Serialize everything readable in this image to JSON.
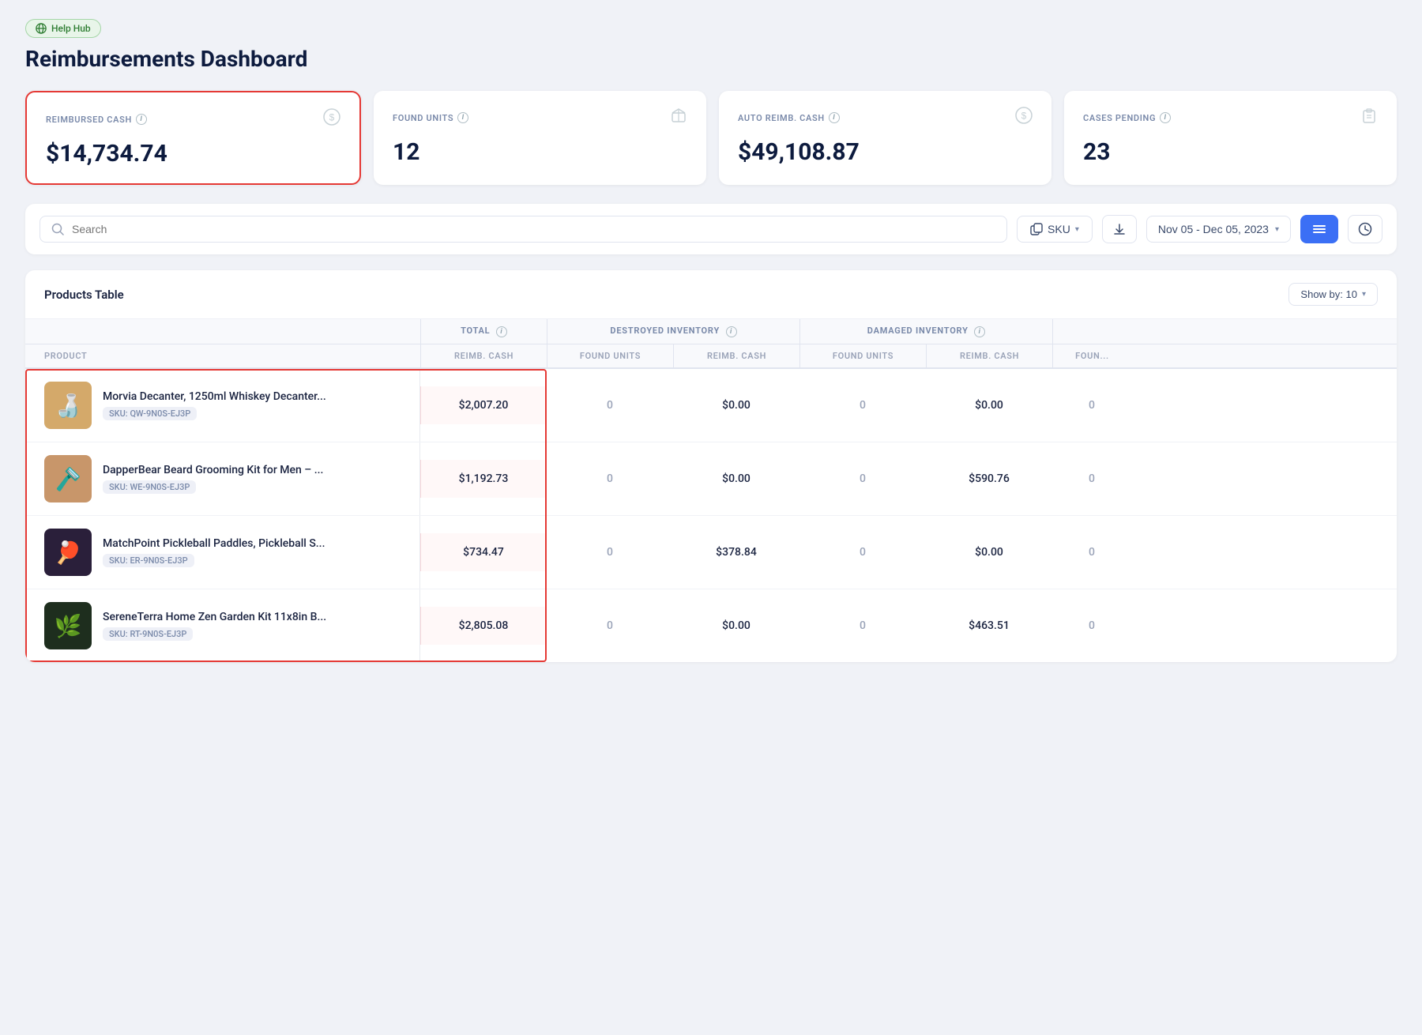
{
  "badge": {
    "label": "Help Hub",
    "icon": "globe"
  },
  "page": {
    "title": "Reimbursements Dashboard"
  },
  "stats": [
    {
      "id": "reimbursed-cash",
      "label": "REIMBURSED CASH",
      "value": "$14,734.74",
      "icon": "dollar",
      "highlighted": true
    },
    {
      "id": "found-units",
      "label": "FOUND UNITS",
      "value": "12",
      "icon": "cube",
      "highlighted": false
    },
    {
      "id": "auto-reimb-cash",
      "label": "AUTO REIMB. CASH",
      "value": "$49,108.87",
      "icon": "dollar",
      "highlighted": false
    },
    {
      "id": "cases-pending",
      "label": "CASES PENDING",
      "value": "23",
      "icon": "clipboard",
      "highlighted": false
    }
  ],
  "toolbar": {
    "search_placeholder": "Search",
    "sku_label": "SKU",
    "date_range": "Nov 05 - Dec 05, 2023",
    "show_by_label": "Show by: 10"
  },
  "table": {
    "title": "Products Table",
    "show_by_label": "Show by: 10",
    "col_groups": [
      {
        "label": "",
        "span": 1
      },
      {
        "label": "TOTAL",
        "span": 2
      },
      {
        "label": "DESTROYED INVENTORY",
        "span": 2
      },
      {
        "label": "DAMAGED INVENTORY",
        "span": 2
      }
    ],
    "sub_cols": [
      "PRODUCT",
      "REIMB. CASH",
      "FOUND UNITS",
      "REIMB. CASH",
      "FOUND UNITS",
      "REIMB. CASH",
      "FOUN..."
    ],
    "rows": [
      {
        "name": "Morvia Decanter, 1250ml Whiskey Decanter...",
        "sku": "QW-9N0S-EJ3P",
        "reimb_cash_total": "$2,007.20",
        "found_units_total": "0",
        "destroyed_reimb": "$0.00",
        "destroyed_found": "0",
        "damaged_reimb": "$0.00",
        "damaged_found": "0",
        "thumb_bg": "#d4a96a",
        "thumb_label": "🍶"
      },
      {
        "name": "DapperBear Beard Grooming Kit for Men – ...",
        "sku": "WE-9N0S-EJ3P",
        "reimb_cash_total": "$1,192.73",
        "found_units_total": "0",
        "destroyed_reimb": "$0.00",
        "destroyed_found": "0",
        "damaged_reimb": "$590.76",
        "damaged_found": "0",
        "thumb_bg": "#b0896a",
        "thumb_label": "🪒"
      },
      {
        "name": "MatchPoint Pickleball Paddles, Pickleball S...",
        "sku": "ER-9N0S-EJ3P",
        "reimb_cash_total": "$734.47",
        "found_units_total": "0",
        "destroyed_reimb": "$378.84",
        "destroyed_found": "0",
        "damaged_reimb": "$0.00",
        "damaged_found": "0",
        "thumb_bg": "#3a2a4a",
        "thumb_label": "🏓"
      },
      {
        "name": "SereneTerra Home Zen Garden Kit 11x8in B...",
        "sku": "RT-9N0S-EJ3P",
        "reimb_cash_total": "$2,805.08",
        "found_units_total": "0",
        "destroyed_reimb": "$0.00",
        "destroyed_found": "0",
        "damaged_reimb": "$463.51",
        "damaged_found": "0",
        "thumb_bg": "#2a3a2a",
        "thumb_label": "🌿"
      }
    ]
  }
}
